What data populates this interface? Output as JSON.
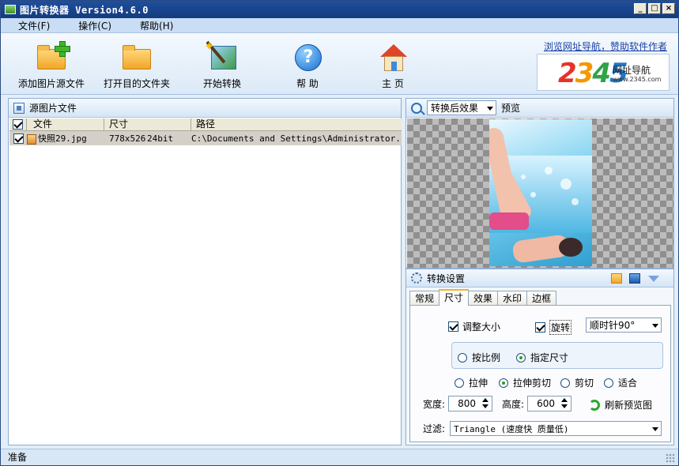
{
  "window": {
    "title": "图片转换器 Version4.6.0"
  },
  "menu": {
    "items": [
      "文件(F)",
      "操作(C)",
      "帮助(H)"
    ]
  },
  "toolbar": {
    "add_source": "添加图片源文件",
    "open_dest": "打开目的文件夹",
    "start_convert": "开始转换",
    "help": "帮 助",
    "home": "主 页"
  },
  "ad": {
    "link": "浏览网址导航，赞助软件作者",
    "brand_digits": [
      "2",
      "3",
      "4",
      "5"
    ],
    "brand_text": "网址导航",
    "brand_url": "www.2345.com"
  },
  "source_panel": {
    "title": "源图片文件",
    "columns": [
      "文件",
      "尺寸",
      "路径"
    ],
    "rows": [
      {
        "name": "快照29.jpg",
        "size": "778x526",
        "bits": "24bit",
        "path": "C:\\Documents and Settings\\Administrator..."
      }
    ]
  },
  "preview": {
    "mode": "转换后效果",
    "label": "预览"
  },
  "settings": {
    "title": "转换设置",
    "tabs": [
      "常规",
      "尺寸",
      "效果",
      "水印",
      "边框"
    ],
    "active_tab": "尺寸",
    "resize_label": "调整大小",
    "rotate_label": "旋转",
    "rotate_value": "顺时针90°",
    "by_ratio": "按比例",
    "by_size": "指定尺寸",
    "fit_modes": [
      "拉伸",
      "拉伸剪切",
      "剪切",
      "适合"
    ],
    "width_label": "宽度:",
    "width_value": "800",
    "height_label": "高度:",
    "height_value": "600",
    "refresh_label": "刷新预览图",
    "filter_label": "过滤:",
    "filter_value": "Triangle (速度快 质量低)"
  },
  "status": {
    "text": "准备"
  }
}
